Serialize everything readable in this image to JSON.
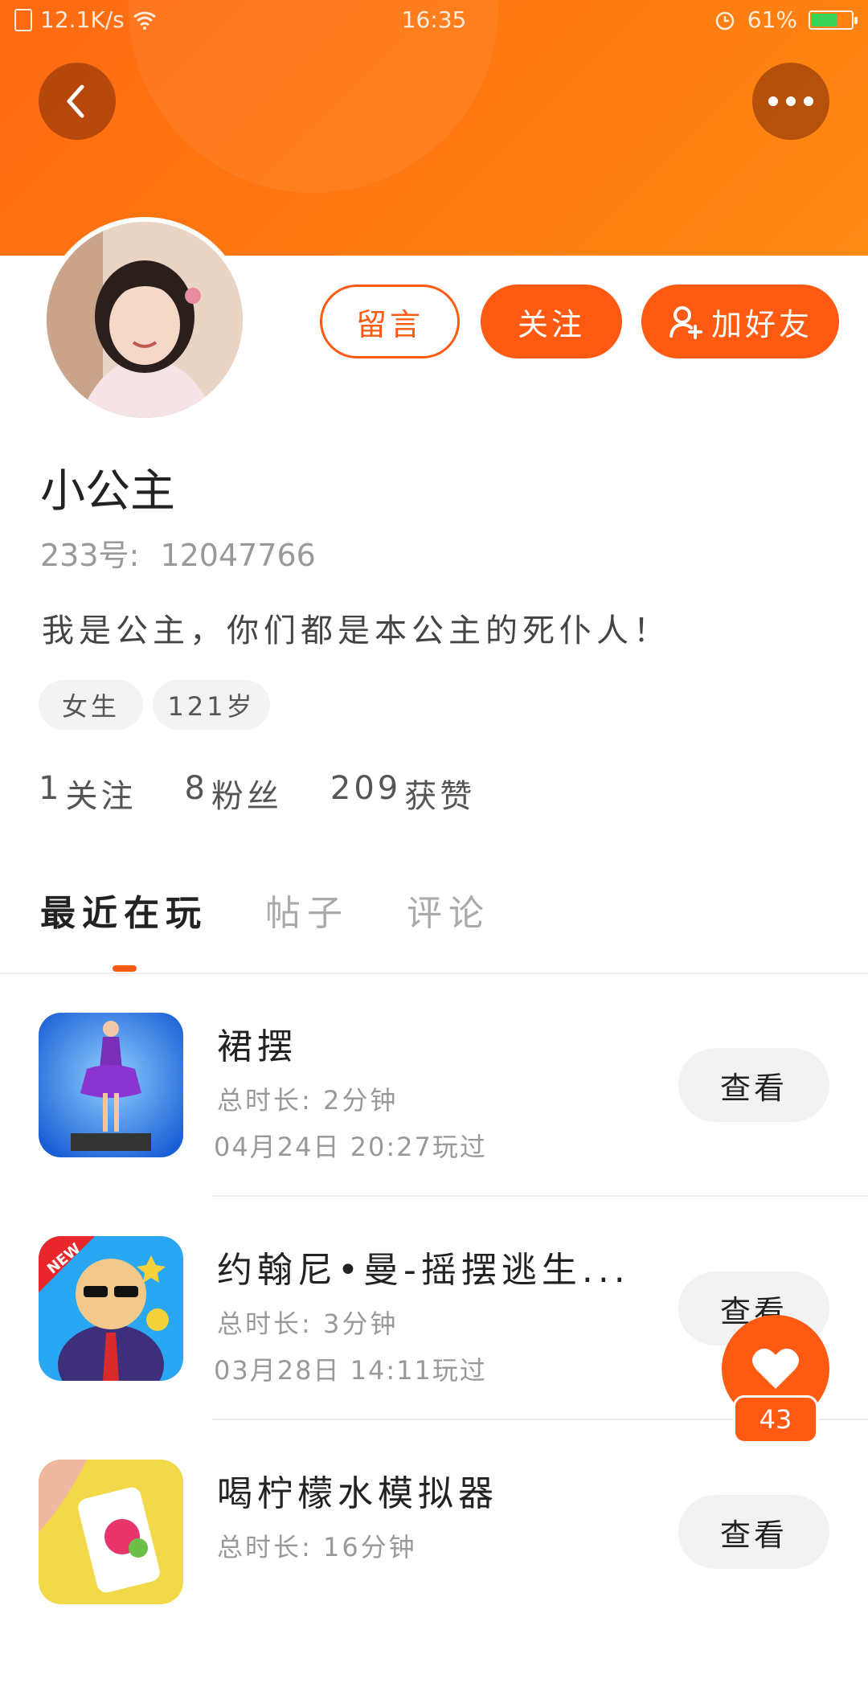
{
  "status_bar": {
    "net_speed": "12.1K/s",
    "time": "16:35",
    "battery": "61%",
    "battery_level": 0.61
  },
  "header": {
    "back_icon": "chevron-left-icon",
    "more_icon": "more-dots-icon",
    "accent_color": "#ff5a12"
  },
  "profile": {
    "actions": {
      "message_label": "留言",
      "follow_label": "关注",
      "add_friend_label": "加好友"
    },
    "name": "小公主",
    "id_label": "233号:",
    "id_value": "12047766",
    "bio": "我是公主，你们都是本公主的死仆人！",
    "tags": {
      "gender": "女生",
      "age": "121岁"
    },
    "stats": {
      "following_count": "1",
      "following_label": "关注",
      "fans_count": "8",
      "fans_label": "粉丝",
      "likes_count": "209",
      "likes_label": "获赞"
    }
  },
  "tabs": {
    "recent": "最近在玩",
    "posts": "帖子",
    "comments": "评论"
  },
  "games": [
    {
      "title": "裙摆",
      "duration": "总时长: 2分钟",
      "played": "04月24日 20:27玩过",
      "view_label": "查看"
    },
    {
      "title": "约翰尼•曼-摇摆逃生...",
      "duration": "总时长: 3分钟",
      "played": "03月28日 14:11玩过",
      "view_label": "查看",
      "badge": "NEW"
    },
    {
      "title": "喝柠檬水模拟器",
      "duration": "总时长: 16分钟",
      "played": "",
      "view_label": "查看"
    }
  ],
  "like_fab": {
    "count": "43",
    "icon": "heart-icon"
  }
}
